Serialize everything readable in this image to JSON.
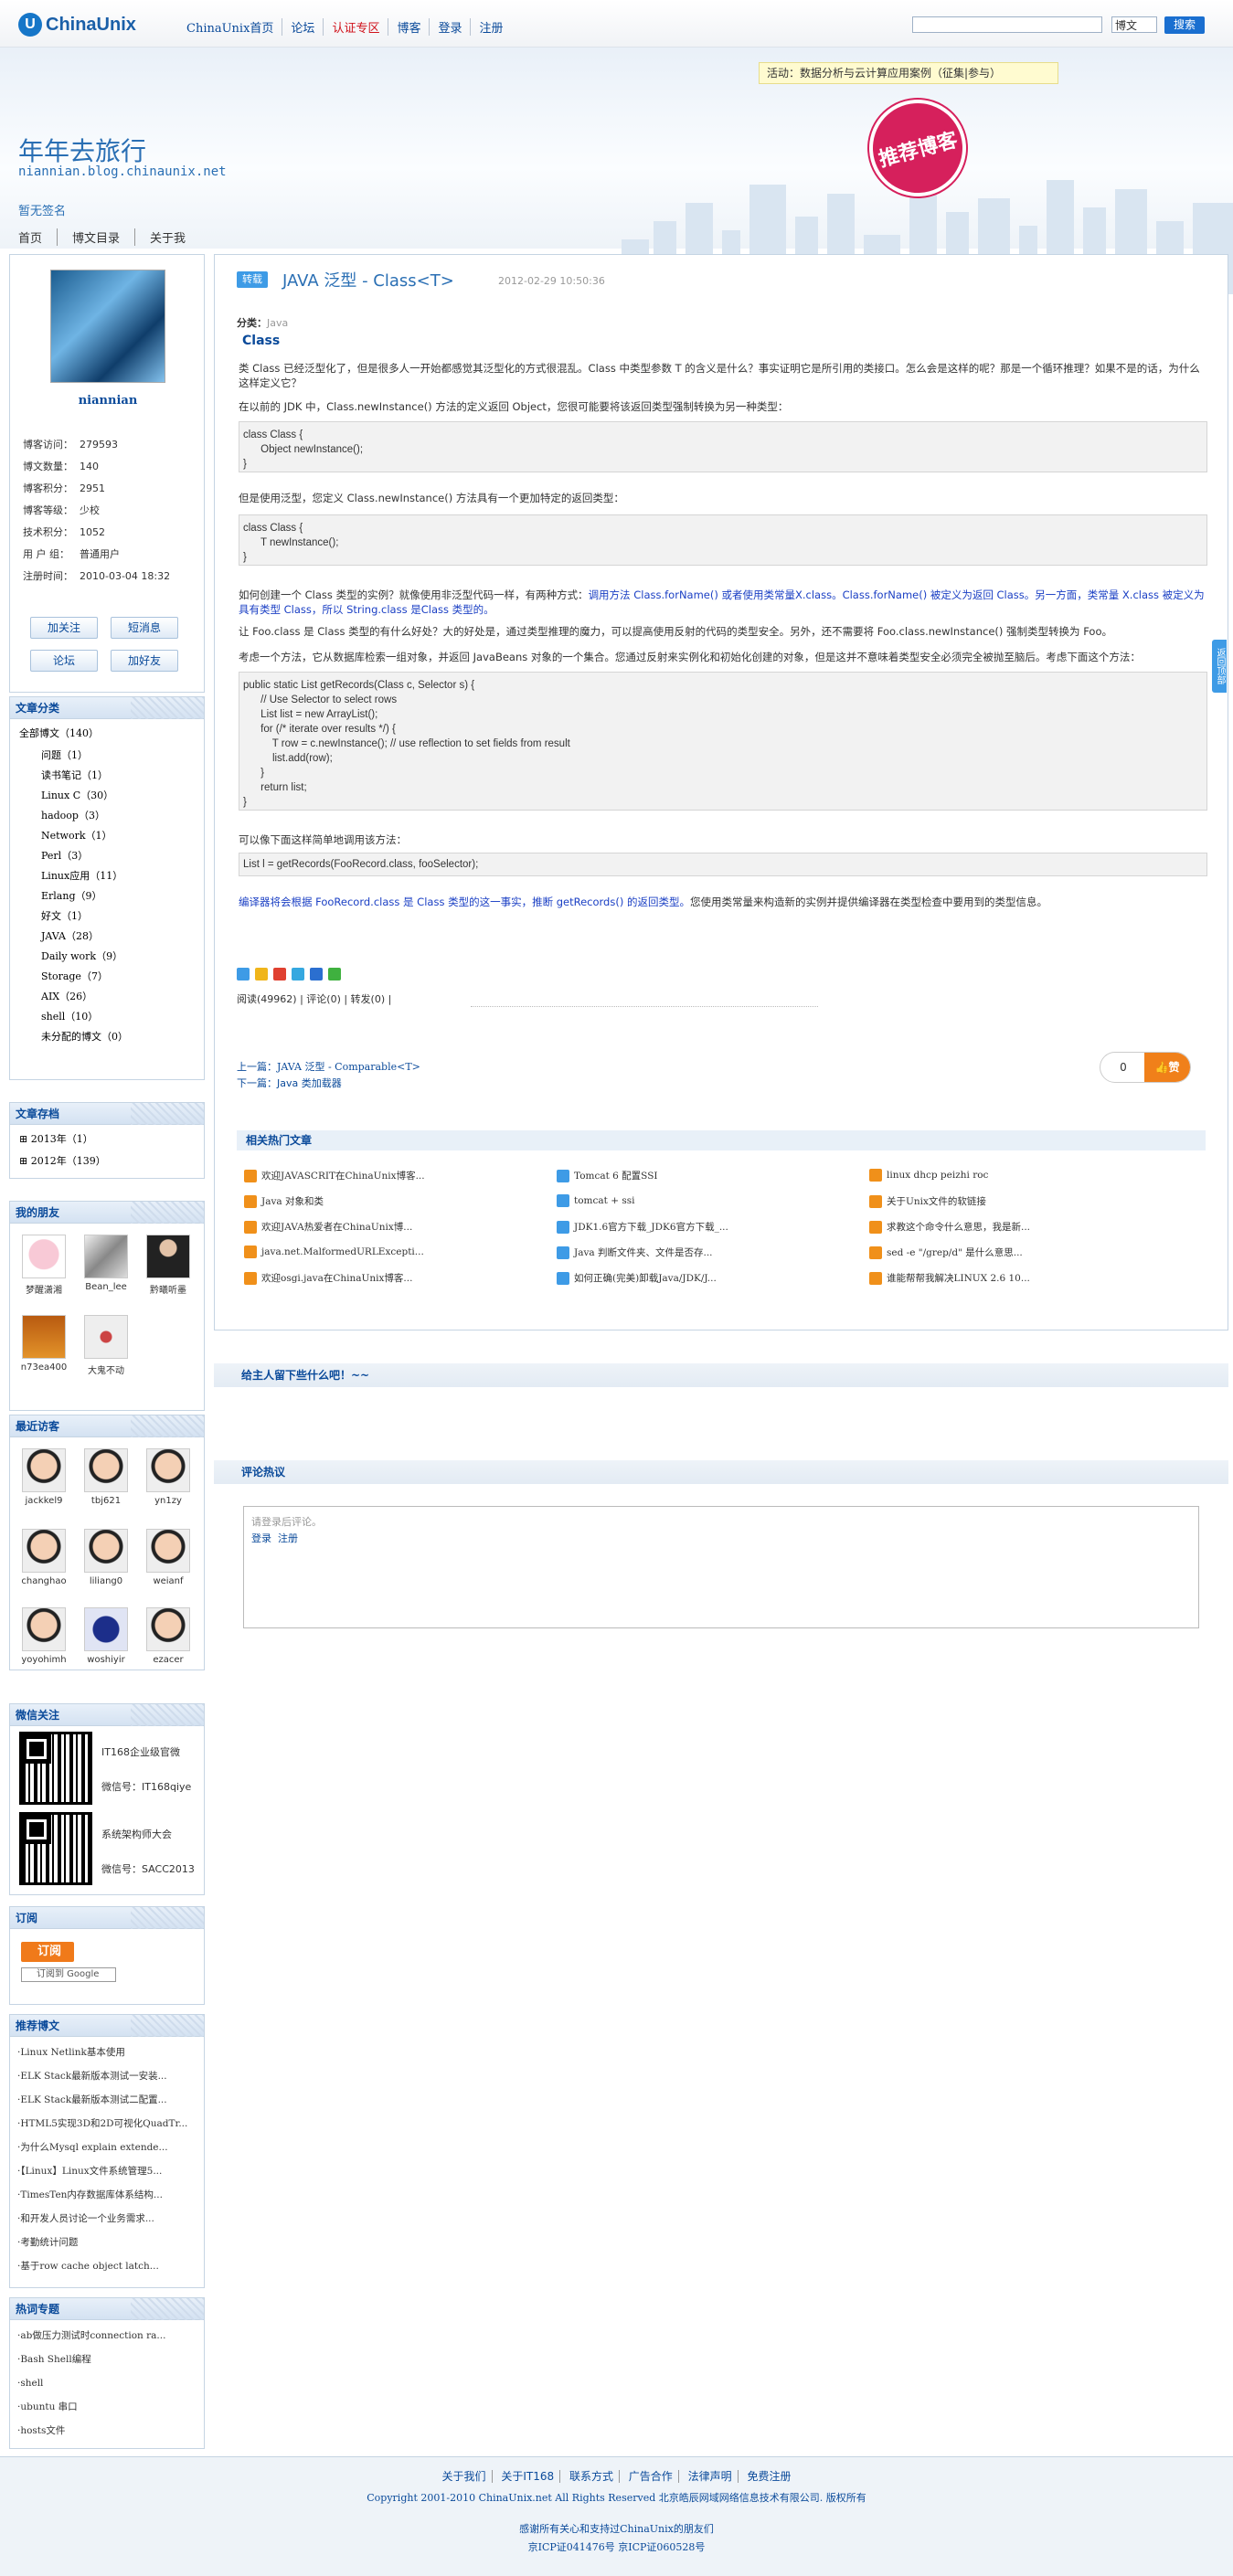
{
  "topbar": {
    "logo_mark": "U",
    "logo_text": "ChinaUnix",
    "nav": [
      "ChinaUnix首页",
      "论坛",
      "认证专区",
      "博客",
      "登录",
      "注册"
    ],
    "search_placeholder": "",
    "search_scope": "博文",
    "search_button": "搜索"
  },
  "header": {
    "title": "年年去旅行",
    "url": "niannian.blog.chinaunix.net",
    "signature": "暂无签名",
    "notice": "活动：数据分析与云计算应用案例（征集|参与）",
    "stamp": "推荐博客",
    "nav": [
      "首页",
      "博文目录",
      "关于我"
    ]
  },
  "profile": {
    "name": "niannian",
    "stats": [
      {
        "k": "博客访问：",
        "v": "279593"
      },
      {
        "k": "博文数量：",
        "v": "140"
      },
      {
        "k": "博客积分：",
        "v": "2951"
      },
      {
        "k": "博客等级：",
        "v": "少校"
      },
      {
        "k": "技术积分：",
        "v": "1052"
      },
      {
        "k": "用 户 组：",
        "v": "普通用户"
      },
      {
        "k": "注册时间：",
        "v": "2010-03-04 18:32"
      }
    ],
    "buttons": [
      "加关注",
      "短消息",
      "论坛",
      "加好友"
    ]
  },
  "categories": {
    "title": "文章分类",
    "all": "全部博文（140）",
    "items": [
      "问题（1）",
      "读书笔记（1）",
      "Linux C（30）",
      "hadoop（3）",
      "Network（1）",
      "Perl（3）",
      "Linux应用（11）",
      "Erlang（9）",
      "好文（1）",
      "JAVA（28）",
      "Daily work（9）",
      "Storage（7）",
      "AIX（26）",
      "shell（10）",
      "未分配的博文（0）"
    ]
  },
  "archive": {
    "title": "文章存档",
    "items": [
      "2013年（1）",
      "2012年（139）"
    ]
  },
  "friends": {
    "title": "我的朋友",
    "items": [
      "梦醒潇湘",
      "Bean_lee",
      "黔曦听墨",
      "n73ea400",
      "大鬼不动"
    ]
  },
  "visitors": {
    "title": "最近访客",
    "items": [
      "jackkel9",
      "tbj621",
      "yn1zy",
      "changhao",
      "liliang0",
      "weianf",
      "yoyohimh",
      "woshiyir",
      "ezacer"
    ]
  },
  "wechat": {
    "title": "微信关注",
    "items": [
      {
        "name": "IT168企业级官微",
        "id": "微信号：IT168qiye"
      },
      {
        "name": "系统架构师大会",
        "id": "微信号：SACC2013"
      }
    ]
  },
  "subscribe": {
    "title": "订阅",
    "rss": "订阅",
    "google": "订阅到 Google"
  },
  "recommended": {
    "title": "推荐博文",
    "items": [
      "·Linux Netlink基本使用",
      "·ELK Stack最新版本测试一安装...",
      "·ELK Stack最新版本测试二配置...",
      "·HTML5实现3D和2D可视化QuadTr...",
      "·为什么Mysql explain extende...",
      "·【Linux】Linux文件系统管理5...",
      "·TimesTen内存数据库体系结构...",
      "·和开发人员讨论一个业务需求...",
      "·考勤统计问题",
      "·基于row cache object latch..."
    ]
  },
  "hot": {
    "title": "热词专题",
    "items": [
      "·ab做压力测试时connection ra...",
      "·Bash Shell编程",
      "·shell",
      "·ubuntu 串口",
      "·hosts文件"
    ]
  },
  "article": {
    "tag": "转载",
    "title": "JAVA 泛型 - Class<T>",
    "date": "2012-02-29 10:50:36",
    "cat_label": "分类：",
    "cat": "Java",
    "subheading": "Class",
    "p1": "类 Class 已经泛型化了，但是很多人一开始都感觉其泛型化的方式很混乱。Class 中类型参数 T 的含义是什么？事实证明它是所引用的类接口。怎么会是这样的呢？那是一个循环推理？如果不是的话，为什么这样定义它？",
    "p2": "在以前的 JDK 中，Class.newInstance() 方法的定义返回 Object，您很可能要将该返回类型强制转换为另一种类型：",
    "code1": "class Class {\n      Object newInstance();\n}",
    "p3": "但是使用泛型，您定义 Class.newInstance() 方法具有一个更加特定的返回类型：",
    "code2": "class Class {\n      T newInstance();\n}",
    "p4a": "如何创建一个 Class 类型的实例？就像使用非泛型代码一样，有两种方式：",
    "p4b": "调用方法 Class.forName() 或者使用类常量X.class。Class.forName() 被定义为返回 Class。另一方面，类常量 X.class 被定义为具有类型 Class，所以 String.class 是Class 类型的。",
    "p5": "让 Foo.class 是 Class 类型的有什么好处？大的好处是，通过类型推理的魔力，可以提高使用反射的代码的类型安全。另外，还不需要将 Foo.class.newInstance() 强制类型转换为 Foo。",
    "p6": "考虑一个方法，它从数据库检索一组对象，并返回 JavaBeans 对象的一个集合。您通过反射来实例化和初始化创建的对象，但是这并不意味着类型安全必须完全被抛至脑后。考虑下面这个方法：",
    "code3": "public static List getRecords(Class c, Selector s) {\n      // Use Selector to select rows\n      List list = new ArrayList();\n      for (/* iterate over results */) {\n          T row = c.newInstance(); // use reflection to set fields from result\n          list.add(row);\n      }\n      return list;\n}",
    "p7": "可以像下面这样简单地调用该方法：",
    "code4": "List l = getRecords(FooRecord.class, fooSelector);",
    "p8a": "编译器将会根据 FooRecord.class 是 Class 类型的这一事实，推断 getRecords() 的返回类型。",
    "p8b": "您使用类常量来构造新的实例并提供编译器在类型检查中要用到的类型信息。",
    "meta": "阅读(49962) | 评论(0) | 转发(0) |",
    "prev": "上一篇：JAVA 泛型 - Comparable<T>",
    "next": "下一篇：Java 类加载器",
    "likes": "0",
    "like_btn": "赞"
  },
  "related": {
    "title": "相关热门文章",
    "col1": [
      "欢迎JAVASCRIT在ChinaUnix博客...",
      "Java 对象和类",
      "欢迎JAVA热爱者在ChinaUnix博...",
      "java.net.MalformedURLExcepti...",
      "欢迎osgi.java在ChinaUnix博客..."
    ],
    "col2": [
      "Tomcat 6 配置SSI",
      "tomcat + ssi",
      "JDK1.6官方下载_JDK6官方下载_...",
      "Java 判断文件夹、文件是否存...",
      "如何正确(完美)卸载Java/JDK/J..."
    ],
    "col3": [
      "linux dhcp peizhi roc",
      "关于Unix文件的软链接",
      "求教这个命令什么意思，我是新...",
      "sed -e \"/grep/d\" 是什么意思...",
      "谁能帮帮我解决LINUX 2.6 10..."
    ]
  },
  "leave_msg": "给主人留下些什么吧！~~",
  "comments": {
    "title": "评论热议",
    "placeholder": "请登录后评论。",
    "login": "登录",
    "register": "注册"
  },
  "float_tab": "返回顶部",
  "footer": {
    "nav": [
      "关于我们",
      "关于IT168",
      "联系方式",
      "广告合作",
      "法律声明",
      "免费注册"
    ],
    "copyright": "Copyright 2001-2010 ChinaUnix.net All Rights Reserved 北京皓辰网域网络信息技术有限公司. 版权所有",
    "thanks": "感谢所有关心和支持过ChinaUnix的朋友们",
    "icp1": "京ICP证041476号 京ICP证060528号"
  }
}
